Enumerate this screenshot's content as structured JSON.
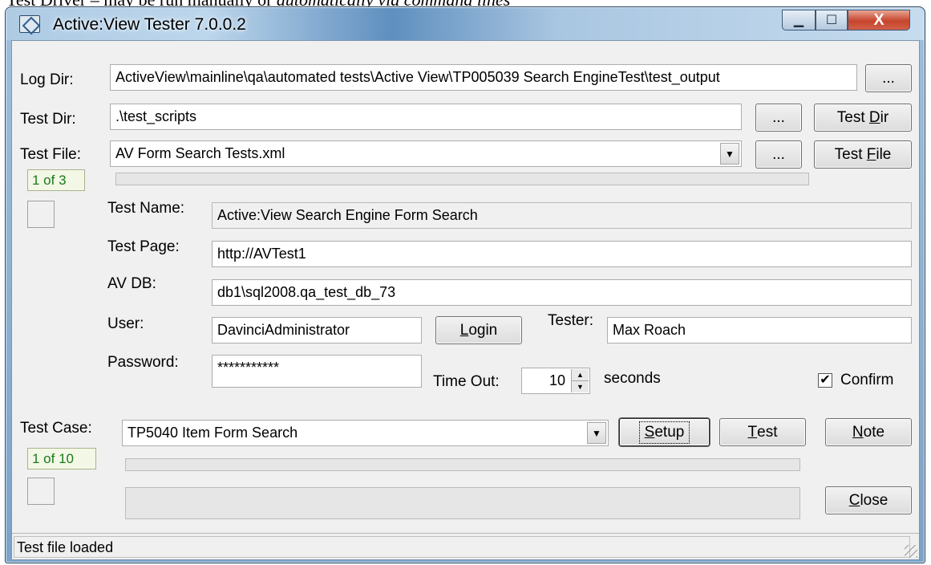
{
  "doc_caption": {
    "prefix": "Test Driver – may be run manually or ",
    "italic": "automatically via command lines"
  },
  "window": {
    "title": "Active:View Tester 7.0.0.2",
    "caption_minimize": "▁",
    "caption_maximize": "☐",
    "caption_close": "X"
  },
  "log_dir": {
    "label": "Log Dir:",
    "value": "ActiveView\\mainline\\qa\\automated tests\\Active View\\TP005039 Search EngineTest\\test_output",
    "browse": "..."
  },
  "test_dir": {
    "label": "Test Dir:",
    "value": ".\\test_scripts",
    "browse": "...",
    "button_pre": "Test ",
    "button_key": "D",
    "button_post": "ir"
  },
  "test_file": {
    "label": "Test File:",
    "value": "AV Form Search Tests.xml",
    "browse": "...",
    "button_pre": "Test ",
    "button_key": "F",
    "button_post": "ile",
    "counter": "1 of 3"
  },
  "test_name": {
    "label": "Test Name:",
    "value": "Active:View Search Engine Form Search"
  },
  "test_page": {
    "label": "Test Page:",
    "value": "http://AVTest1"
  },
  "av_db": {
    "label": "AV DB:",
    "value": "db1\\sql2008.qa_test_db_73"
  },
  "user": {
    "label": "User:",
    "value": "DavinciAdministrator"
  },
  "login_button": {
    "key": "L",
    "rest": "ogin"
  },
  "tester": {
    "label": "Tester:",
    "value": "Max Roach"
  },
  "password": {
    "label": "Password:",
    "value": "***********"
  },
  "timeout": {
    "label": "Time Out:",
    "value": "10",
    "unit": "seconds"
  },
  "confirm": {
    "label": "Confirm",
    "checked": true,
    "mark": "✔"
  },
  "test_case": {
    "label": "Test Case:",
    "value": "TP5040 Item Form Search",
    "counter": "1 of 10"
  },
  "setup_button": {
    "key": "S",
    "rest": "etup"
  },
  "test_button": {
    "key": "T",
    "rest": "est"
  },
  "note_button": {
    "key": "N",
    "rest": "ote"
  },
  "close_button": {
    "key": "C",
    "rest": "lose"
  },
  "status": {
    "text": "Test file loaded"
  },
  "icons": {
    "dropdown": "▼",
    "spin_up": "▲",
    "spin_down": "▼"
  }
}
